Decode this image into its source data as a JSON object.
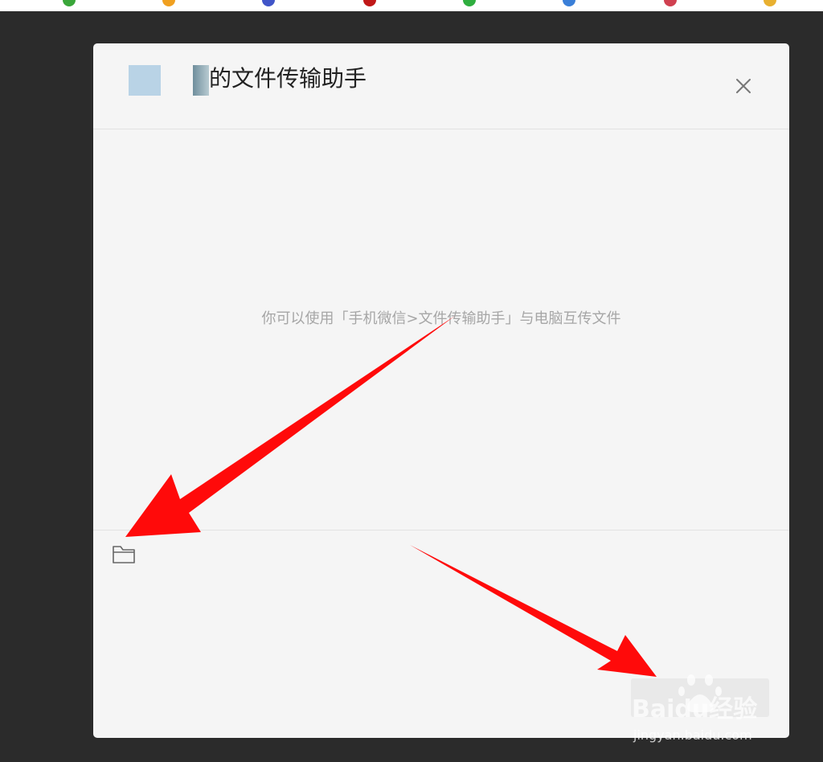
{
  "dialog": {
    "title": "的文件传输助手",
    "hint": "你可以使用「手机微信>文件传输助手」与电脑互传文件",
    "send_label": ""
  },
  "icons": {
    "close": "close-icon",
    "folder": "folder-icon"
  },
  "watermark": {
    "brand": "Baidu经验",
    "url": "jingyan.baidu.com"
  },
  "colors": {
    "backdrop": "#2b2b2b",
    "dialog_bg": "#f5f5f5",
    "hint_text": "#a6a6a6",
    "arrow": "#ff0a0a"
  }
}
